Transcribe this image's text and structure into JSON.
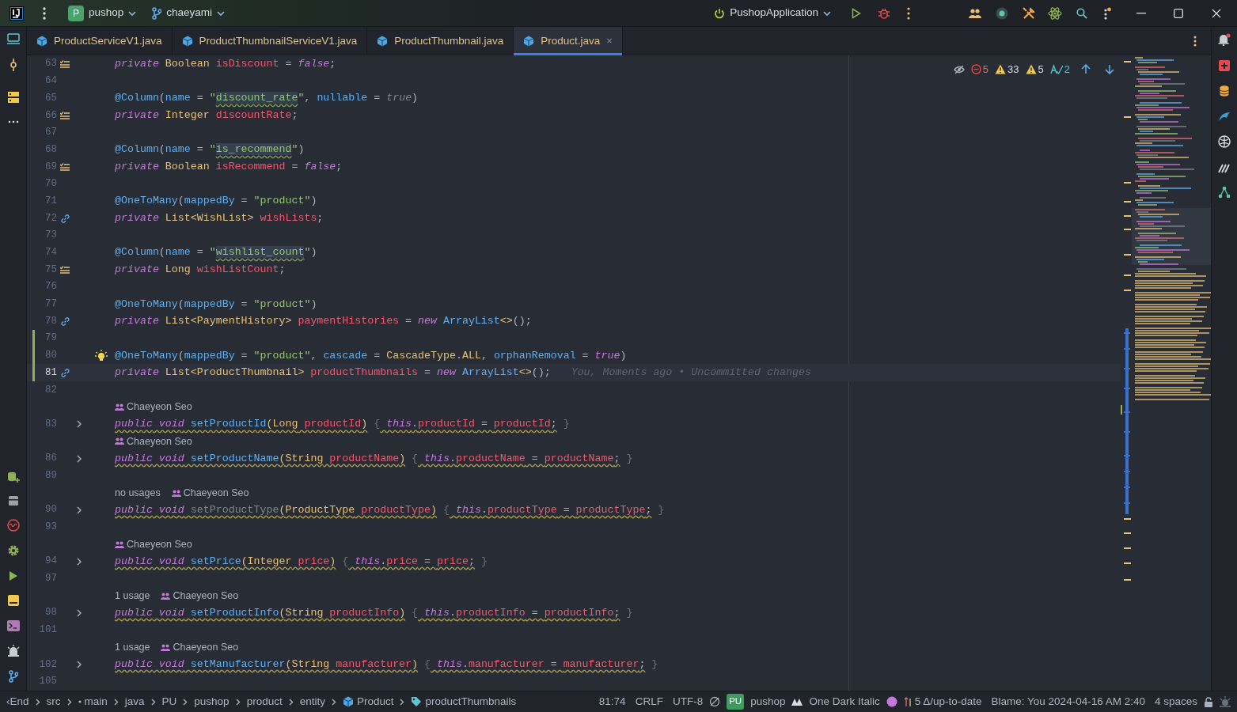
{
  "top_bar": {
    "project": {
      "badge": "P",
      "name": "pushop"
    },
    "branch": "chaeyami",
    "run_config": "PushopApplication"
  },
  "tabs": [
    {
      "label": "ProductServiceV1.java",
      "selected": false
    },
    {
      "label": "ProductThumbnailServiceV1.java",
      "selected": false
    },
    {
      "label": "ProductThumbnail.java",
      "selected": false
    },
    {
      "label": "Product.java",
      "selected": true,
      "close": "×"
    }
  ],
  "inspections": {
    "errors": "5",
    "warnings": "33",
    "weak_warnings": "5",
    "typos": "2"
  },
  "lines": [
    {
      "kind": "code",
      "number": "63",
      "gutter_mark": {
        "kind": "field"
      },
      "changed": false,
      "current": false,
      "warning": false,
      "tokens": [
        {
          "text": "private",
          "kind": "kw"
        },
        {
          "text": " Boolean",
          "kind": "type"
        },
        {
          "text": " isDiscount",
          "kind": "field"
        },
        {
          "text": " = ",
          "kind": "op"
        },
        {
          "text": "false",
          "kind": "lit"
        },
        {
          "text": ";",
          "kind": "op"
        }
      ]
    },
    {
      "kind": "code",
      "number": "64",
      "changed": false,
      "current": false
    },
    {
      "kind": "code",
      "number": "65",
      "changed": false,
      "current": false,
      "warning": false,
      "tokens": [
        {
          "text": "@Column",
          "kind": "ann"
        },
        {
          "text": "(",
          "kind": "op"
        },
        {
          "text": "name",
          "kind": "ann"
        },
        {
          "text": " = ",
          "kind": "op"
        },
        {
          "text": "\"",
          "kind": "str"
        },
        {
          "text": "discount_rate",
          "kind": "strref"
        },
        {
          "text": "\"",
          "kind": "str"
        },
        {
          "text": ", ",
          "kind": "op"
        },
        {
          "text": "nullable",
          "kind": "ann"
        },
        {
          "text": " = ",
          "kind": "op"
        },
        {
          "text": "true",
          "kind": "dim"
        },
        {
          "text": ")",
          "kind": "op"
        }
      ]
    },
    {
      "kind": "code",
      "number": "66",
      "gutter_mark": {
        "kind": "field"
      },
      "changed": false,
      "current": false,
      "warning": false,
      "tokens": [
        {
          "text": "private",
          "kind": "kw"
        },
        {
          "text": " Integer",
          "kind": "type"
        },
        {
          "text": " discountRate",
          "kind": "field"
        },
        {
          "text": ";",
          "kind": "op"
        }
      ]
    },
    {
      "kind": "code",
      "number": "67",
      "changed": false,
      "current": false
    },
    {
      "kind": "code",
      "number": "68",
      "changed": false,
      "current": false,
      "warning": false,
      "tokens": [
        {
          "text": "@Column",
          "kind": "ann"
        },
        {
          "text": "(",
          "kind": "op"
        },
        {
          "text": "name",
          "kind": "ann"
        },
        {
          "text": " = ",
          "kind": "op"
        },
        {
          "text": "\"",
          "kind": "str"
        },
        {
          "text": "is_recommend",
          "kind": "strref"
        },
        {
          "text": "\"",
          "kind": "str"
        },
        {
          "text": ")",
          "kind": "op"
        }
      ]
    },
    {
      "kind": "code",
      "number": "69",
      "gutter_mark": {
        "kind": "field"
      },
      "changed": false,
      "current": false,
      "warning": false,
      "tokens": [
        {
          "text": "private",
          "kind": "kw"
        },
        {
          "text": " Boolean",
          "kind": "type"
        },
        {
          "text": " isRecommend",
          "kind": "field"
        },
        {
          "text": " = ",
          "kind": "op"
        },
        {
          "text": "false",
          "kind": "lit"
        },
        {
          "text": ";",
          "kind": "op"
        }
      ]
    },
    {
      "kind": "code",
      "number": "70",
      "changed": false,
      "current": false
    },
    {
      "kind": "code",
      "number": "71",
      "changed": false,
      "current": false,
      "warning": false,
      "tokens": [
        {
          "text": "@OneToMany",
          "kind": "ann"
        },
        {
          "text": "(",
          "kind": "op"
        },
        {
          "text": "mappedBy",
          "kind": "ann"
        },
        {
          "text": " = ",
          "kind": "op"
        },
        {
          "text": "\"product\"",
          "kind": "str"
        },
        {
          "text": ")",
          "kind": "op"
        }
      ]
    },
    {
      "kind": "code",
      "number": "72",
      "gutter_mark": {
        "kind": "link"
      },
      "changed": false,
      "current": false,
      "warning": false,
      "tokens": [
        {
          "text": "private",
          "kind": "kw"
        },
        {
          "text": " List<WishList>",
          "kind": "type"
        },
        {
          "text": " wishLists",
          "kind": "field"
        },
        {
          "text": ";",
          "kind": "op"
        }
      ]
    },
    {
      "kind": "code",
      "number": "73",
      "changed": false,
      "current": false
    },
    {
      "kind": "code",
      "number": "74",
      "changed": false,
      "current": false,
      "warning": false,
      "tokens": [
        {
          "text": "@Column",
          "kind": "ann"
        },
        {
          "text": "(",
          "kind": "op"
        },
        {
          "text": "name",
          "kind": "ann"
        },
        {
          "text": " = ",
          "kind": "op"
        },
        {
          "text": "\"",
          "kind": "str"
        },
        {
          "text": "wishlist_count",
          "kind": "strref"
        },
        {
          "text": "\"",
          "kind": "str"
        },
        {
          "text": ")",
          "kind": "op"
        }
      ]
    },
    {
      "kind": "code",
      "number": "75",
      "gutter_mark": {
        "kind": "field"
      },
      "changed": false,
      "current": false,
      "warning": false,
      "tokens": [
        {
          "text": "private",
          "kind": "kw"
        },
        {
          "text": " Long",
          "kind": "type"
        },
        {
          "text": " wishListCount",
          "kind": "field"
        },
        {
          "text": ";",
          "kind": "op"
        }
      ]
    },
    {
      "kind": "code",
      "number": "76",
      "changed": false,
      "current": false
    },
    {
      "kind": "code",
      "number": "77",
      "changed": false,
      "current": false,
      "warning": false,
      "tokens": [
        {
          "text": "@OneToMany",
          "kind": "ann"
        },
        {
          "text": "(",
          "kind": "op"
        },
        {
          "text": "mappedBy",
          "kind": "ann"
        },
        {
          "text": " = ",
          "kind": "op"
        },
        {
          "text": "\"product\"",
          "kind": "str"
        },
        {
          "text": ")",
          "kind": "op"
        }
      ]
    },
    {
      "kind": "code",
      "number": "78",
      "gutter_mark": {
        "kind": "link"
      },
      "changed": false,
      "current": false,
      "warning": false,
      "tokens": [
        {
          "text": "private",
          "kind": "kw"
        },
        {
          "text": " List<PaymentHistory>",
          "kind": "type"
        },
        {
          "text": " paymentHistories",
          "kind": "field"
        },
        {
          "text": " = ",
          "kind": "op"
        },
        {
          "text": "new",
          "kind": "lit"
        },
        {
          "text": " ArrayList",
          "kind": "ann"
        },
        {
          "text": "<>",
          "kind": "type"
        },
        {
          "text": "();",
          "kind": "op"
        }
      ]
    },
    {
      "kind": "code",
      "number": "79",
      "changed": true,
      "current": false
    },
    {
      "kind": "code",
      "number": "80",
      "gutter_mark": {
        "kind": "bulb"
      },
      "changed": true,
      "current": false,
      "warning": false,
      "tokens": [
        {
          "text": "@OneToMany",
          "kind": "ann"
        },
        {
          "text": "(",
          "kind": "op"
        },
        {
          "text": "mappedBy",
          "kind": "ann"
        },
        {
          "text": " = ",
          "kind": "op"
        },
        {
          "text": "\"product\"",
          "kind": "str"
        },
        {
          "text": ", ",
          "kind": "op"
        },
        {
          "text": "cascade",
          "kind": "ann"
        },
        {
          "text": " = ",
          "kind": "op"
        },
        {
          "text": "CascadeType",
          "kind": "type"
        },
        {
          "text": ".",
          "kind": "op"
        },
        {
          "text": "ALL",
          "kind": "type"
        },
        {
          "text": ", ",
          "kind": "op"
        },
        {
          "text": "orphanRemoval",
          "kind": "ann"
        },
        {
          "text": " = ",
          "kind": "op"
        },
        {
          "text": "true",
          "kind": "lit"
        },
        {
          "text": ")",
          "kind": "op"
        }
      ]
    },
    {
      "kind": "code",
      "number": "81",
      "gutter_mark": {
        "kind": "link"
      },
      "changed": true,
      "current": true,
      "warning": false,
      "tokens": [
        {
          "text": "private",
          "kind": "kw"
        },
        {
          "text": " List<ProductThumbnail>",
          "kind": "type"
        },
        {
          "text": " productThumbnails",
          "kind": "field"
        },
        {
          "text": " = ",
          "kind": "op"
        },
        {
          "text": "new",
          "kind": "lit"
        },
        {
          "text": " ArrayList",
          "kind": "ann"
        },
        {
          "text": "<>",
          "kind": "type"
        },
        {
          "text": "();",
          "kind": "op"
        }
      ],
      "blame": "You, Moments ago • Uncommitted changes"
    },
    {
      "kind": "code",
      "number": "82",
      "changed": false,
      "current": false
    },
    {
      "kind": "hint",
      "author": "Chaeyeon Seo"
    },
    {
      "kind": "code",
      "number": "83",
      "gutter_mark": {
        "kind": "fold"
      },
      "changed": false,
      "current": false,
      "warning": true,
      "tokens": [
        {
          "text": "public",
          "kind": "kw"
        },
        {
          "text": " void",
          "kind": "kw"
        },
        {
          "text": " setProductId",
          "kind": "method"
        },
        {
          "text": "(",
          "kind": "paren"
        },
        {
          "text": "Long",
          "kind": "type"
        },
        {
          "text": " productId",
          "kind": "field"
        },
        {
          "text": ")",
          "kind": "paren"
        },
        {
          "text": " {",
          "kind": "brace"
        },
        {
          "text": " this",
          "kind": "kw"
        },
        {
          "text": ".",
          "kind": "op"
        },
        {
          "text": "productId",
          "kind": "field"
        },
        {
          "text": " = ",
          "kind": "op"
        },
        {
          "text": "productId",
          "kind": "field"
        },
        {
          "text": ";",
          "kind": "op"
        },
        {
          "text": " }",
          "kind": "brace"
        }
      ]
    },
    {
      "kind": "hint",
      "author": "Chaeyeon Seo"
    },
    {
      "kind": "code",
      "number": "86",
      "gutter_mark": {
        "kind": "fold"
      },
      "changed": false,
      "current": false,
      "warning": true,
      "tokens": [
        {
          "text": "public",
          "kind": "kw"
        },
        {
          "text": " void",
          "kind": "kw"
        },
        {
          "text": " setProductName",
          "kind": "method"
        },
        {
          "text": "(",
          "kind": "paren"
        },
        {
          "text": "String",
          "kind": "type"
        },
        {
          "text": " productName",
          "kind": "field"
        },
        {
          "text": ")",
          "kind": "paren"
        },
        {
          "text": " {",
          "kind": "brace"
        },
        {
          "text": " this",
          "kind": "kw"
        },
        {
          "text": ".",
          "kind": "op"
        },
        {
          "text": "productName",
          "kind": "field"
        },
        {
          "text": " = ",
          "kind": "op"
        },
        {
          "text": "productName",
          "kind": "field"
        },
        {
          "text": ";",
          "kind": "op"
        },
        {
          "text": " }",
          "kind": "brace"
        }
      ]
    },
    {
      "kind": "code",
      "number": "89",
      "changed": false,
      "current": false
    },
    {
      "kind": "hint",
      "usages": "no usages",
      "author": "Chaeyeon Seo"
    },
    {
      "kind": "code",
      "number": "90",
      "gutter_mark": {
        "kind": "fold"
      },
      "changed": false,
      "current": false,
      "warning": true,
      "tokens": [
        {
          "text": "public",
          "kind": "kw"
        },
        {
          "text": " void",
          "kind": "kw"
        },
        {
          "text": " setProductType",
          "kind": "unused"
        },
        {
          "text": "(",
          "kind": "paren"
        },
        {
          "text": "ProductType",
          "kind": "type"
        },
        {
          "text": " productType",
          "kind": "field"
        },
        {
          "text": ")",
          "kind": "paren"
        },
        {
          "text": " {",
          "kind": "brace"
        },
        {
          "text": " this",
          "kind": "kw"
        },
        {
          "text": ".",
          "kind": "op"
        },
        {
          "text": "productType",
          "kind": "field"
        },
        {
          "text": " = ",
          "kind": "op"
        },
        {
          "text": "productType",
          "kind": "field"
        },
        {
          "text": ";",
          "kind": "op"
        },
        {
          "text": " }",
          "kind": "brace"
        }
      ]
    },
    {
      "kind": "code",
      "number": "93",
      "changed": false,
      "current": false
    },
    {
      "kind": "hint",
      "author": "Chaeyeon Seo"
    },
    {
      "kind": "code",
      "number": "94",
      "gutter_mark": {
        "kind": "fold"
      },
      "changed": false,
      "current": false,
      "warning": true,
      "tokens": [
        {
          "text": "public",
          "kind": "kw"
        },
        {
          "text": " void",
          "kind": "kw"
        },
        {
          "text": " setPrice",
          "kind": "method"
        },
        {
          "text": "(",
          "kind": "paren"
        },
        {
          "text": "Integer",
          "kind": "type"
        },
        {
          "text": " price",
          "kind": "field"
        },
        {
          "text": ")",
          "kind": "paren"
        },
        {
          "text": " {",
          "kind": "brace"
        },
        {
          "text": " this",
          "kind": "kw"
        },
        {
          "text": ".",
          "kind": "op"
        },
        {
          "text": "price",
          "kind": "field"
        },
        {
          "text": " = ",
          "kind": "op"
        },
        {
          "text": "price",
          "kind": "field"
        },
        {
          "text": ";",
          "kind": "op"
        },
        {
          "text": " }",
          "kind": "brace"
        }
      ]
    },
    {
      "kind": "code",
      "number": "97",
      "changed": false,
      "current": false
    },
    {
      "kind": "hint",
      "usages": "1 usage",
      "author": "Chaeyeon Seo"
    },
    {
      "kind": "code",
      "number": "98",
      "gutter_mark": {
        "kind": "fold"
      },
      "changed": false,
      "current": false,
      "warning": true,
      "tokens": [
        {
          "text": "public",
          "kind": "kw"
        },
        {
          "text": " void",
          "kind": "kw"
        },
        {
          "text": " setProductInfo",
          "kind": "method"
        },
        {
          "text": "(",
          "kind": "paren"
        },
        {
          "text": "String",
          "kind": "type"
        },
        {
          "text": " productInfo",
          "kind": "field"
        },
        {
          "text": ")",
          "kind": "paren"
        },
        {
          "text": " {",
          "kind": "brace"
        },
        {
          "text": " this",
          "kind": "kw"
        },
        {
          "text": ".",
          "kind": "op"
        },
        {
          "text": "productInfo",
          "kind": "field"
        },
        {
          "text": " = ",
          "kind": "op"
        },
        {
          "text": "productInfo",
          "kind": "field"
        },
        {
          "text": ";",
          "kind": "op"
        },
        {
          "text": " }",
          "kind": "brace"
        }
      ]
    },
    {
      "kind": "code",
      "number": "101",
      "changed": false,
      "current": false
    },
    {
      "kind": "hint",
      "usages": "1 usage",
      "author": "Chaeyeon Seo"
    },
    {
      "kind": "code",
      "number": "102",
      "gutter_mark": {
        "kind": "fold"
      },
      "changed": false,
      "current": false,
      "warning": true,
      "tokens": [
        {
          "text": "public",
          "kind": "kw"
        },
        {
          "text": " void",
          "kind": "kw"
        },
        {
          "text": " setManufacturer",
          "kind": "method"
        },
        {
          "text": "(",
          "kind": "paren"
        },
        {
          "text": "String",
          "kind": "type"
        },
        {
          "text": " manufacturer",
          "kind": "field"
        },
        {
          "text": ")",
          "kind": "paren"
        },
        {
          "text": " {",
          "kind": "brace"
        },
        {
          "text": " this",
          "kind": "kw"
        },
        {
          "text": ".",
          "kind": "op"
        },
        {
          "text": "manufacturer",
          "kind": "field"
        },
        {
          "text": " = ",
          "kind": "op"
        },
        {
          "text": "manufacturer",
          "kind": "field"
        },
        {
          "text": ";",
          "kind": "op"
        },
        {
          "text": " }",
          "kind": "brace"
        }
      ]
    },
    {
      "kind": "code",
      "number": "105",
      "changed": false,
      "current": false
    }
  ],
  "breadcrumbs": [
    {
      "label": "‹End"
    },
    {
      "label": "src"
    },
    {
      "label": "main",
      "kind": "folder"
    },
    {
      "label": "java"
    },
    {
      "label": "PU"
    },
    {
      "label": "pushop"
    },
    {
      "label": "product"
    },
    {
      "label": "entity"
    },
    {
      "label": "Product",
      "kind": "class"
    },
    {
      "label": "productThumbnails",
      "kind": "member"
    }
  ],
  "status": {
    "position": "81:74",
    "line_separator": "CRLF",
    "encoding": "UTF-8",
    "project_badge": "PU",
    "project": "pushop",
    "theme": "One Dark Italic",
    "vcs": "5 Δ/up-to-date",
    "blame": "Blame: You 2024-04-16 AM 2:40",
    "indent": "4 spaces"
  }
}
